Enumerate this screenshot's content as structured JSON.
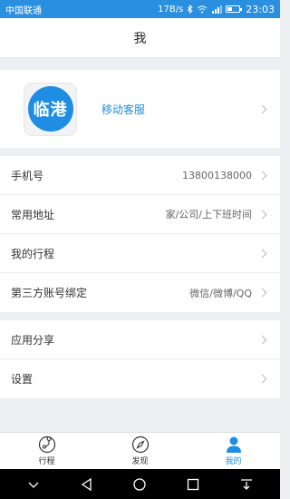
{
  "status_bar": {
    "carrier": "中国联通",
    "speed": "17B/s",
    "time": "23:03"
  },
  "header": {
    "title": "我"
  },
  "profile": {
    "logo_text": "临港",
    "name": "移动客服"
  },
  "list_main": [
    {
      "label": "手机号",
      "value": "13800138000"
    },
    {
      "label": "常用地址",
      "value": "家/公司/上下班时间"
    },
    {
      "label": "我的行程",
      "value": ""
    },
    {
      "label": "第三方账号绑定",
      "value": "微信/微博/QQ"
    }
  ],
  "list_secondary": [
    {
      "label": "应用分享",
      "value": ""
    },
    {
      "label": "设置",
      "value": ""
    }
  ],
  "tabs": [
    {
      "label": "行程",
      "icon": "trip-icon",
      "active": false
    },
    {
      "label": "发现",
      "icon": "compass-icon",
      "active": false
    },
    {
      "label": "我的",
      "icon": "person-icon",
      "active": true
    }
  ],
  "colors": {
    "accent": "#1e8de2",
    "status_bar": "#2b8fe0",
    "background": "#eeeff3"
  }
}
